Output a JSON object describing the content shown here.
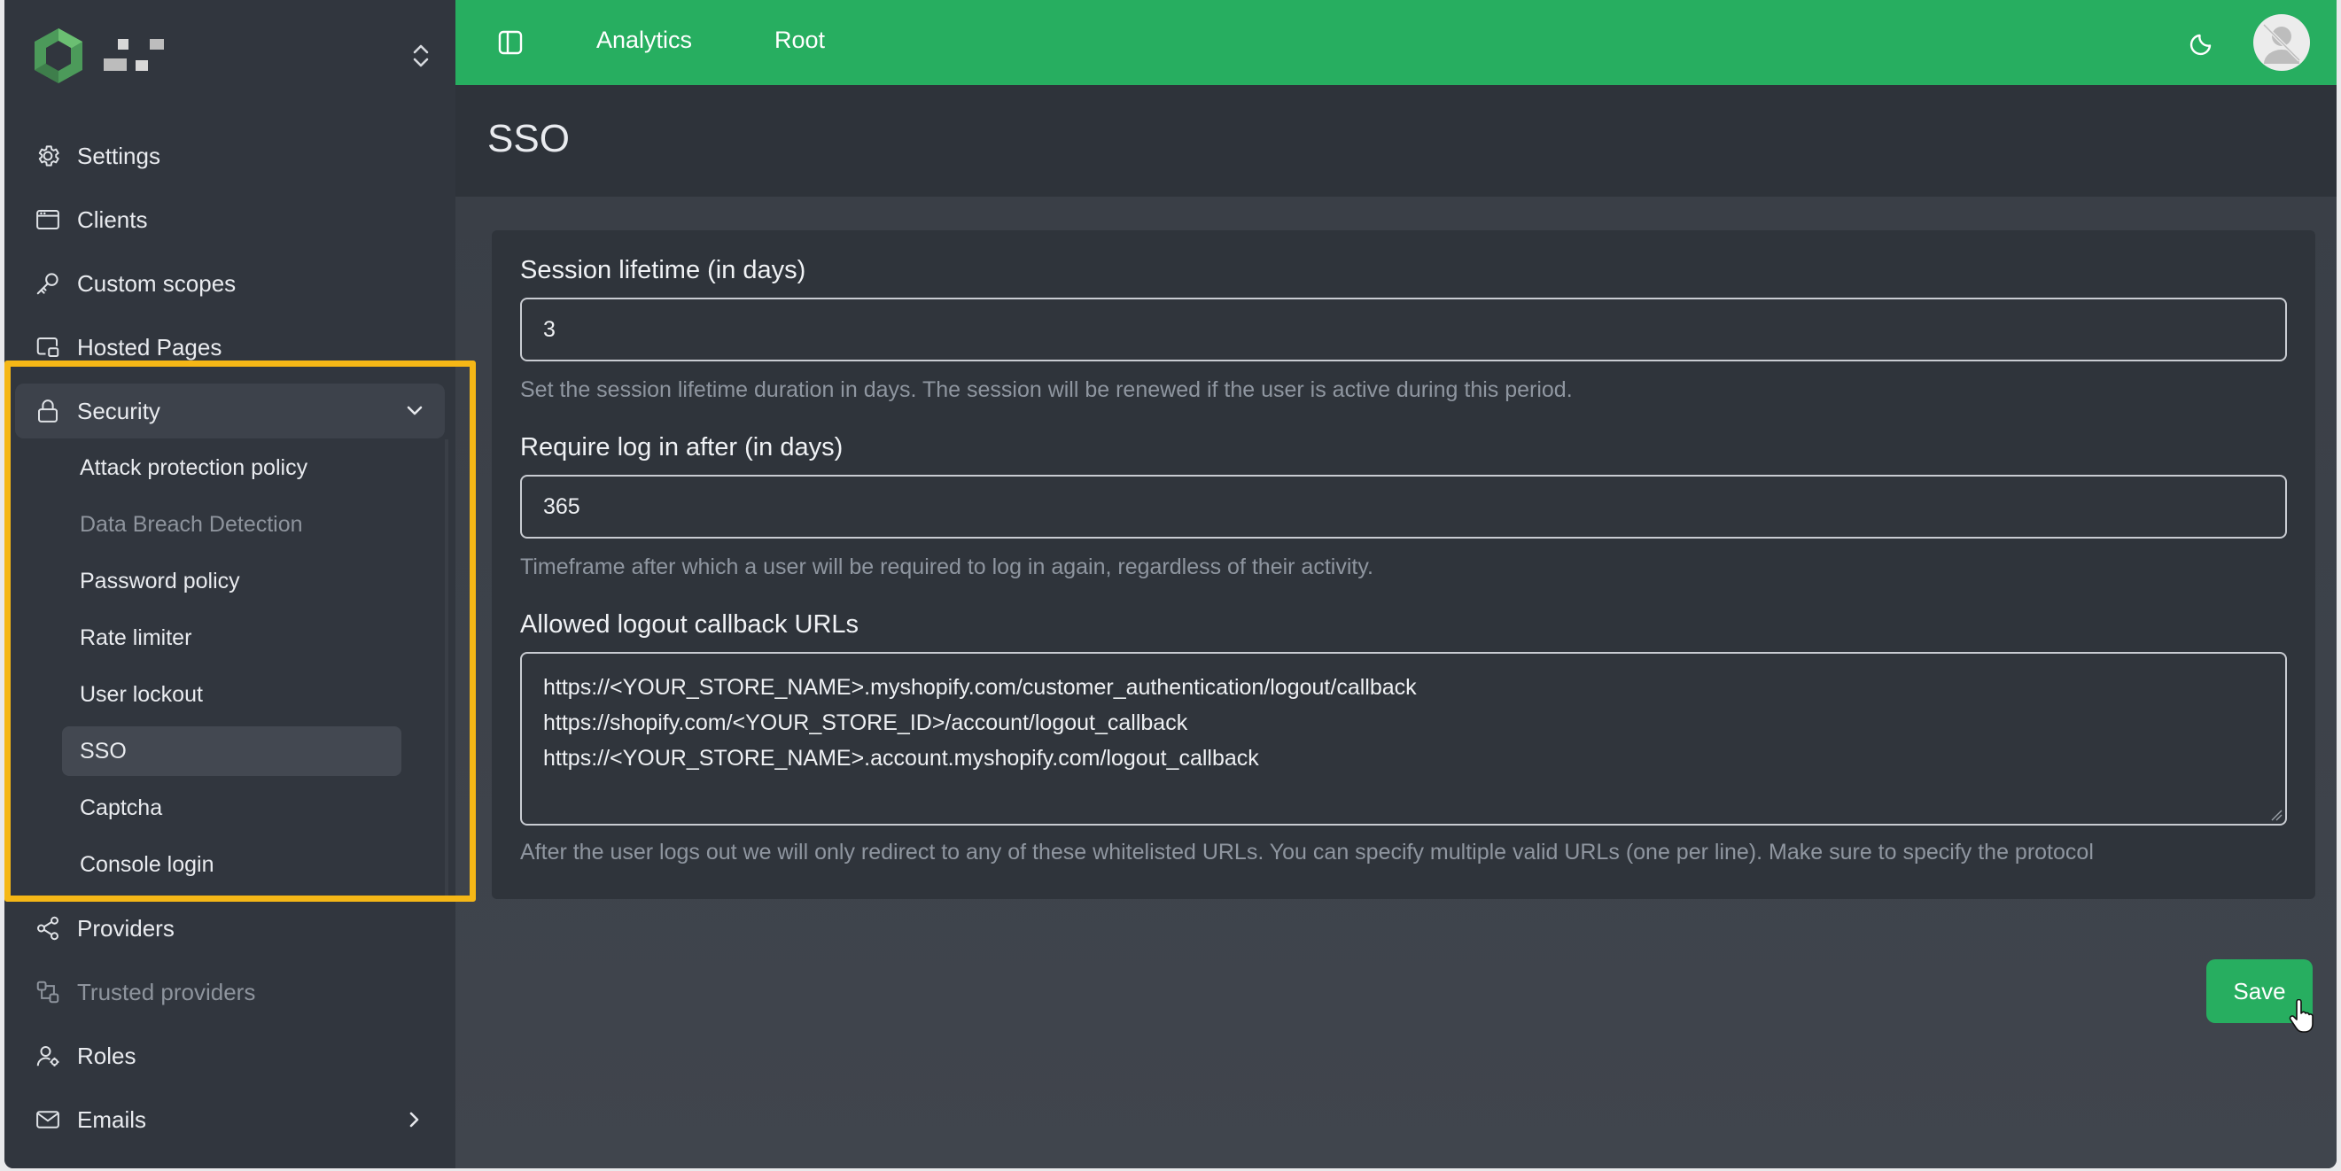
{
  "topbar": {
    "links": [
      "Analytics",
      "Root"
    ]
  },
  "sidebar": {
    "items": [
      {
        "label": "Settings",
        "icon": "gear-icon"
      },
      {
        "label": "Clients",
        "icon": "browser-window-icon"
      },
      {
        "label": "Custom scopes",
        "icon": "key-icon"
      },
      {
        "label": "Hosted Pages",
        "icon": "pages-icon"
      },
      {
        "label": "Security",
        "icon": "lock-icon",
        "expanded": true
      },
      {
        "label": "Providers",
        "icon": "share-icon"
      },
      {
        "label": "Trusted providers",
        "icon": "link-nodes-icon",
        "disabled": true
      },
      {
        "label": "Roles",
        "icon": "user-roles-icon"
      },
      {
        "label": "Emails",
        "icon": "mail-icon"
      }
    ],
    "security_subitems": [
      {
        "label": "Attack protection policy"
      },
      {
        "label": "Data Breach Detection",
        "disabled": true
      },
      {
        "label": "Password policy"
      },
      {
        "label": "Rate limiter"
      },
      {
        "label": "User lockout"
      },
      {
        "label": "SSO",
        "active": true
      },
      {
        "label": "Captcha"
      },
      {
        "label": "Console login"
      }
    ]
  },
  "page": {
    "title": "SSO"
  },
  "form": {
    "session_lifetime": {
      "label": "Session lifetime (in days)",
      "value": "3",
      "help": "Set the session lifetime duration in days. The session will be renewed if the user is active during this period."
    },
    "require_login": {
      "label": "Require log in after (in days)",
      "value": "365",
      "help": "Timeframe after which a user will be required to log in again, regardless of their activity."
    },
    "logout_urls": {
      "label": "Allowed logout callback URLs",
      "lines": [
        "https://<YOUR_STORE_NAME>.myshopify.com/customer_authentication/logout/callback",
        "https://shopify.com/<YOUR_STORE_ID>/account/logout_callback",
        "https://<YOUR_STORE_NAME>.account.myshopify.com/logout_callback"
      ],
      "help": "After the user logs out we will only redirect to any of these whitelisted URLs. You can specify multiple valid URLs (one per line). Make sure to specify the protocol"
    },
    "save_label": "Save"
  },
  "colors": {
    "accent": "#27ae60",
    "highlight": "#f5b716",
    "sidebar_bg": "#31363e",
    "card_bg": "#2f343b"
  }
}
